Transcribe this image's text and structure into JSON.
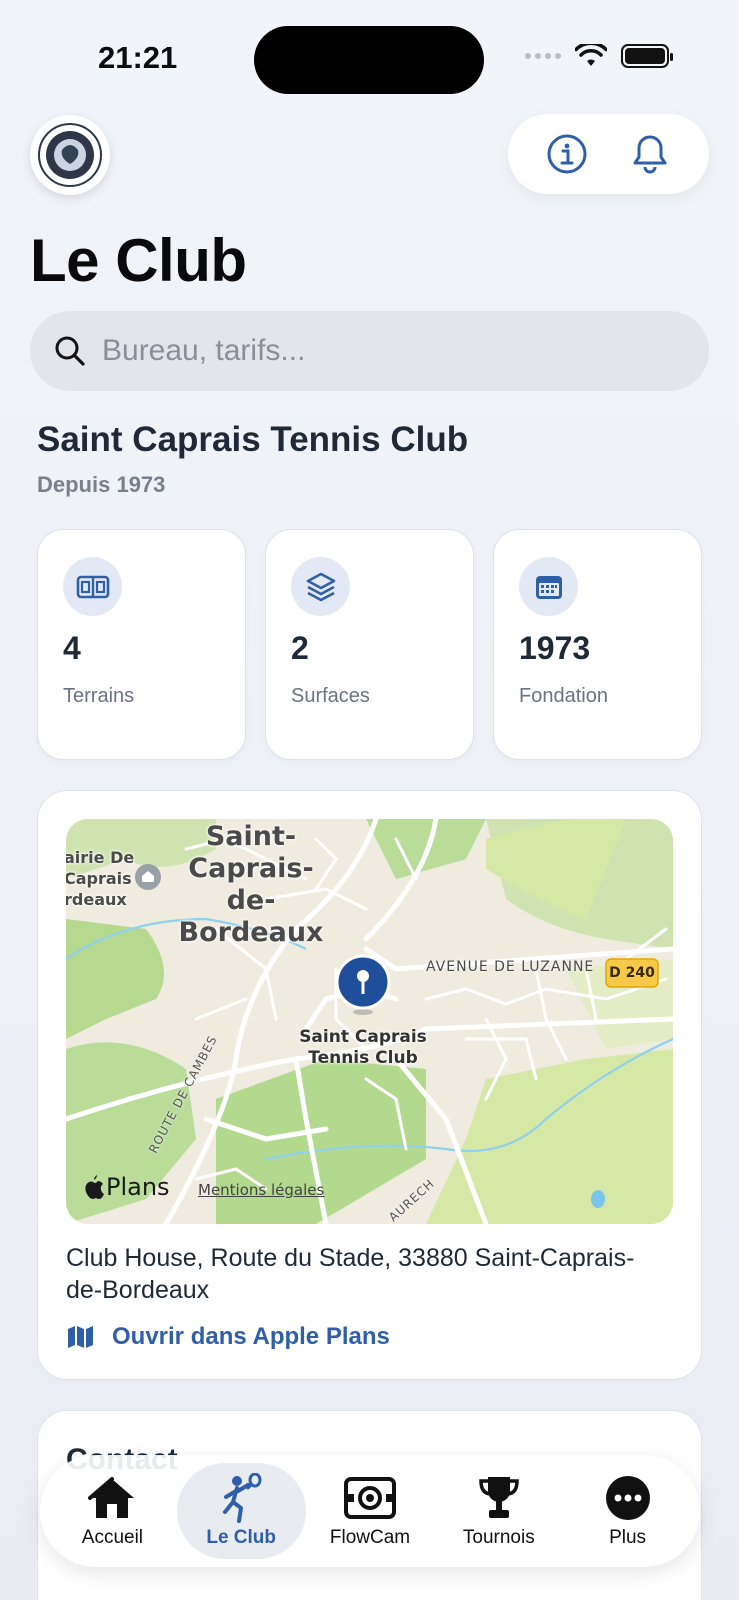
{
  "status_bar": {
    "time": "21:21"
  },
  "header": {
    "title": "Le Club",
    "info_button_icon": "info-icon",
    "notifications_button_icon": "bell-icon"
  },
  "search": {
    "placeholder": "Bureau, tarifs...",
    "value": ""
  },
  "club": {
    "name": "Saint Caprais Tennis Club",
    "since": "Depuis 1973"
  },
  "stats": [
    {
      "icon": "court-icon",
      "value": "4",
      "label": "Terrains"
    },
    {
      "icon": "layers-icon",
      "value": "2",
      "label": "Surfaces"
    },
    {
      "icon": "calendar-icon",
      "value": "1973",
      "label": "Fondation"
    }
  ],
  "map": {
    "town_label_lines": [
      "Saint-",
      "Caprais-",
      "de-",
      "Bordeaux"
    ],
    "mairie_label_lines": [
      "airie De",
      "Caprais",
      "rdeaux"
    ],
    "avenue_label": "AVENUE DE LUZANNE",
    "road_badge": "D 240",
    "pin_label_lines": [
      "Saint Caprais",
      "Tennis Club"
    ],
    "route_label": "ROUTE DE CAMBES",
    "route2_label": "AURECH",
    "brand": "Plans",
    "legal": "Mentions légales"
  },
  "address": "Club House, Route du Stade, 33880 Saint-Caprais-de-Bordeaux",
  "open_maps_label": "Ouvrir dans Apple Plans",
  "contact": {
    "title": "Contact"
  },
  "tabs": [
    {
      "label": "Accueil",
      "icon": "home-icon",
      "active": false
    },
    {
      "label": "Le Club",
      "icon": "tennis-player-icon",
      "active": true
    },
    {
      "label": "FlowCam",
      "icon": "camera-icon",
      "active": false
    },
    {
      "label": "Tournois",
      "icon": "trophy-icon",
      "active": false
    },
    {
      "label": "Plus",
      "icon": "more-icon",
      "active": false
    }
  ],
  "colors": {
    "accent": "#2f5fa8",
    "text": "#1f2937",
    "muted": "#6b7280"
  }
}
